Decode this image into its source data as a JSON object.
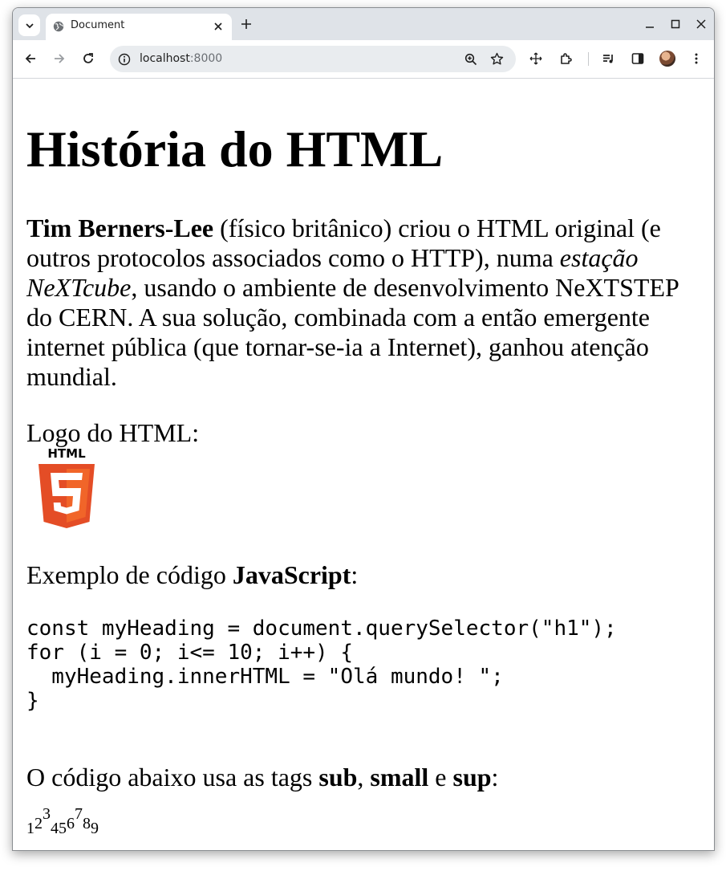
{
  "browser": {
    "tab_title": "Document",
    "url_host": "localhost",
    "url_port": ":8000"
  },
  "page": {
    "title": "História do HTML",
    "para": {
      "bold_name": "Tim Berners-Lee",
      "text1": " (físico britânico) criou o HTML original (e outros protocolos associados como o HTTP), numa ",
      "italic": "estação NeXTcube",
      "text2": ", usando o ambiente de desenvolvimento NeXTSTEP do CERN. A sua solução, combinada com a então emergente internet pública (que tornar-se-ia a Internet), ganhou atenção mundial."
    },
    "logo_label": "Logo do HTML:",
    "logo_text": "HTML",
    "code_label_prefix": "Exemplo de código ",
    "code_label_bold": "JavaScript",
    "code_label_suffix": ":",
    "code_lines": [
      "const myHeading = document.querySelector(\"h1\");",
      "for (i = 0; i<= 10; i++) {",
      "  myHeading.innerHTML = \"Olá mundo! \";",
      "}"
    ],
    "tags_label": {
      "prefix": "O código abaixo usa as tags ",
      "sub": "sub",
      "comma": ", ",
      "small": "small",
      "and": " e ",
      "sup": "sup",
      "suffix": ":"
    },
    "digits": [
      "1",
      "2",
      "3",
      "4",
      "5",
      "6",
      "7",
      "8",
      "9"
    ]
  },
  "colors": {
    "tabstrip_bg": "#dfe3e8",
    "html5_orange": "#e44d26",
    "html5_light": "#f16529"
  }
}
